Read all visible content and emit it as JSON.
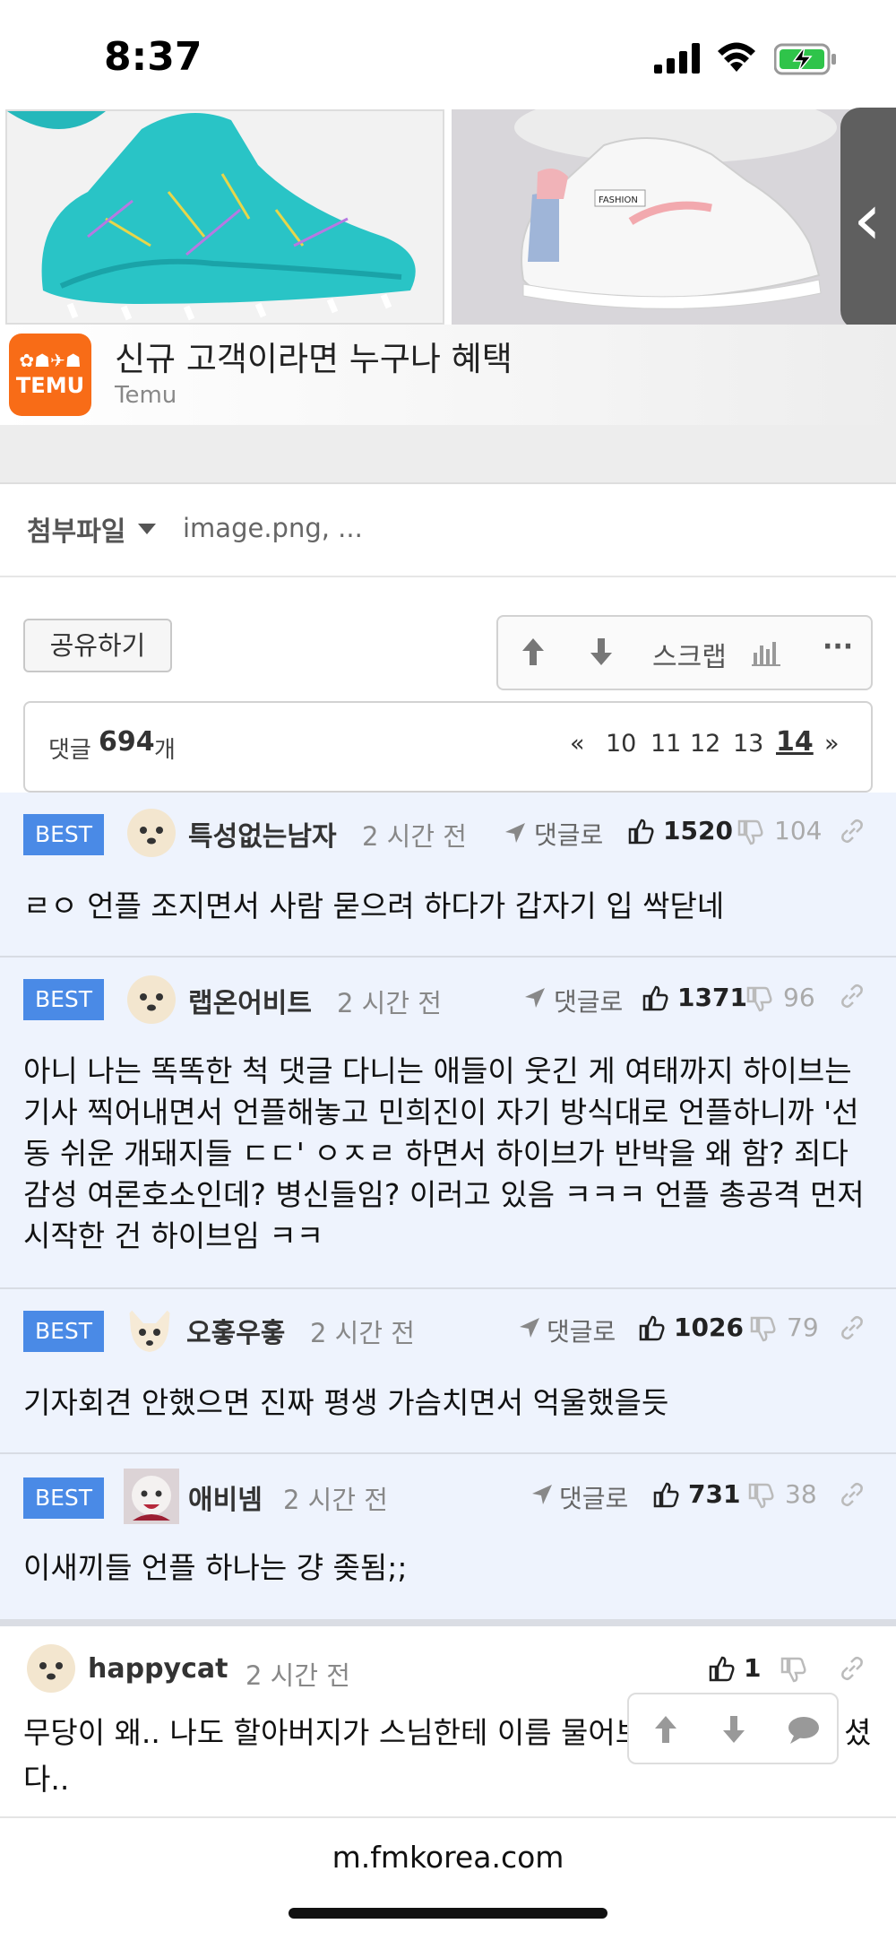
{
  "status_bar": {
    "time": "8:37"
  },
  "ad": {
    "title": "신규 고객이라면 누구나 혜택",
    "advertiser": "Temu",
    "logo_line1": "✿☗✈☗",
    "logo_text": "TEMU",
    "handle_glyph": "‹",
    "shoe_brand_text": "FASHION"
  },
  "attachment": {
    "label": "첨부파일",
    "files": "image.png,  ..."
  },
  "actions": {
    "share": "공유하기",
    "upvote_icon": "arrow-up",
    "downvote_icon": "arrow-down",
    "scrap": "스크랩",
    "stats_icon": "bar-chart",
    "more": "···"
  },
  "comment_bar": {
    "label": "댓글",
    "count": "694",
    "unit": "개",
    "prev": "«",
    "pages": [
      "10",
      "11",
      "12",
      "13",
      "14"
    ],
    "current_page": "14",
    "next": "»"
  },
  "comments": [
    {
      "badge": "BEST",
      "nick": "특성없는남자",
      "time": "2 시간 전",
      "reply": "댓글로",
      "up": "1520",
      "down": "104",
      "text": "ㄹㅇ 언플 조지면서 사람 묻으려 하다가 갑자기 입 싹닫네"
    },
    {
      "badge": "BEST",
      "nick": "랩온어비트",
      "time": "2 시간 전",
      "reply": "댓글로",
      "up": "1371",
      "down": "96",
      "text": "아니 나는 똑똑한 척 댓글 다니는 애들이 웃긴 게 여태까지 하이브는 기사 찍어내면서 언플해놓고 민희진이 자기 방식대로 언플하니까 '선동 쉬운 개돼지들 ㄷㄷ' ㅇㅈㄹ 하면서 하이브가 반박을 왜 함? 죄다 감성 여론호소인데? 병신들임? 이러고 있음 ㅋㅋㅋ 언플 총공격 먼저 시작한 건 하이브임 ㅋㅋ",
      "lines": [
        "아니 나는 똑똑한 척 댓글 다니는 애들이 웃긴 게 여태까지 하이브는",
        "기사 찍어내면서 언플해놓고 민희진이 자기 방식대로 언플하니까 '선",
        "동 쉬운 개돼지들 ㄷㄷ' ㅇㅈㄹ 하면서 하이브가 반박을 왜 함? 죄다",
        "감성 여론호소인데? 병신들임? 이러고 있음 ㅋㅋㅋ 언플 총공격 먼저",
        "시작한 건 하이브임 ㅋㅋ"
      ]
    },
    {
      "badge": "BEST",
      "nick": "오홓우홓",
      "time": "2 시간 전",
      "reply": "댓글로",
      "up": "1026",
      "down": "79",
      "text": "기자회견 안했으면 진짜 평생 가슴치면서 억울했을듯"
    },
    {
      "badge": "BEST",
      "nick": "애비넴",
      "time": "2 시간 전",
      "reply": "댓글로",
      "up": "731",
      "down": "38",
      "text": "이새끼들 언플 하나는 걍 좆됨;;"
    },
    {
      "nick": "happycat",
      "time": "2 시간 전",
      "up": "1",
      "line1": "무당이 왜.. 나도 할아버지가 스님한테 이름 물어보",
      "line1_tail": "셨",
      "line2": "다.."
    }
  ],
  "footer": {
    "url": "m.fmkorea.com"
  }
}
